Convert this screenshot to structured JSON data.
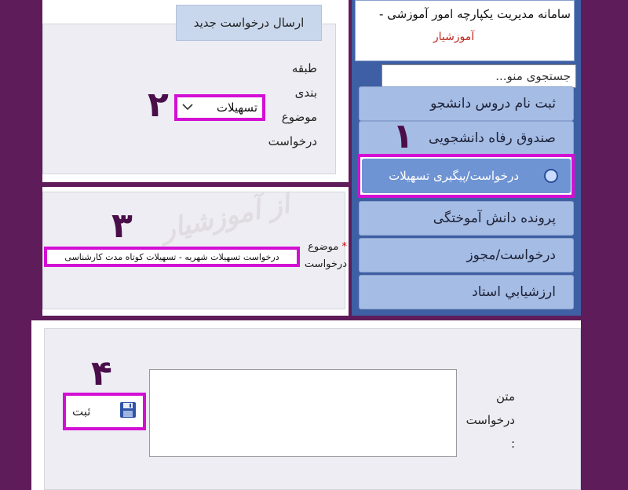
{
  "header": {
    "system_title": "سامانه مدیریت یکپارچه امور آموزشی -",
    "system_subtitle": "آموزشیار"
  },
  "search": {
    "placeholder": "جستجوی منو..."
  },
  "sidebar": {
    "items": [
      {
        "label": "ثبت نام دروس دانشجو"
      },
      {
        "label": "صندوق رفاه دانشجویی"
      },
      {
        "label": "درخواست/پیگیری تسهیلات"
      },
      {
        "label": "پرونده دانش آموختگی"
      },
      {
        "label": "درخواست/مجوز"
      },
      {
        "label": "ارزشيابي استاد"
      }
    ]
  },
  "form": {
    "new_request_button": "ارسال درخواست جدید",
    "category_label": [
      "طبقه",
      "بندی",
      "موضوع",
      "درخواست"
    ],
    "category_value": "تسهیلات",
    "subject_label": [
      "موضوع",
      "درخواست"
    ],
    "subject_required_mark": "*",
    "subject_value": "درخواست تسهیلات شهریه - تسهیلات کوتاه مدت کارشناسی",
    "text_label": [
      "متن",
      "درخواست",
      ":"
    ],
    "submit_label": "ثبت",
    "watermark_text": "از آموزشیار"
  },
  "steps": {
    "s1": "۱",
    "s2": "۲",
    "s3": "۳",
    "s4": "۴"
  },
  "colors": {
    "background": "#5e1c5a",
    "menu": "#a5bce4",
    "highlight": "#d40fd4",
    "subtitle": "#c2281e"
  }
}
